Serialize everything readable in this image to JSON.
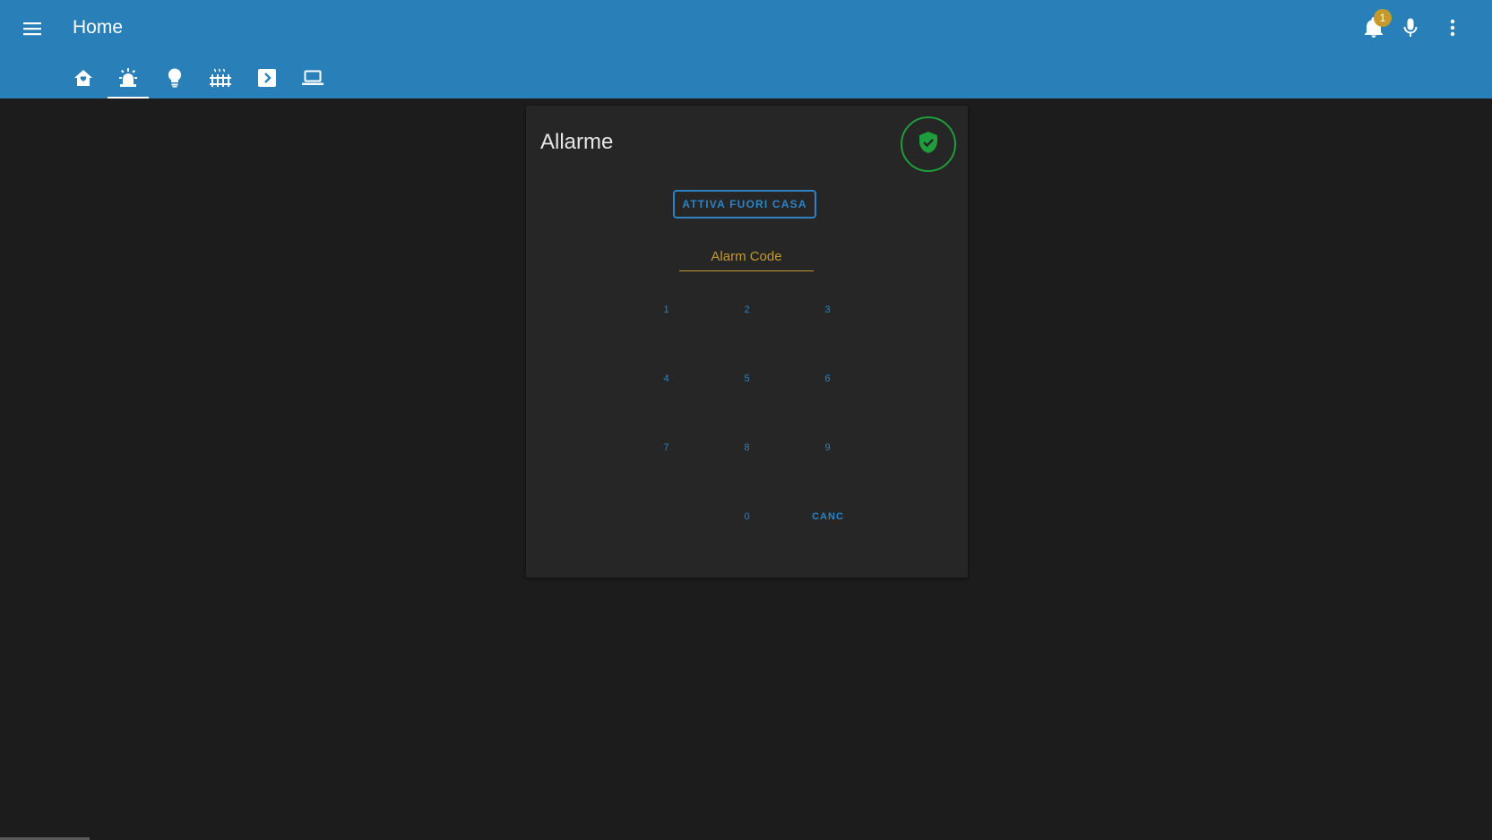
{
  "header": {
    "title": "Home",
    "notification_count": "1",
    "menu_icon": "hamburger-menu-icon",
    "notifications_icon": "bell-icon",
    "voice_icon": "microphone-icon",
    "more_icon": "more-vertical-icon"
  },
  "tabs": [
    {
      "icon": "home-icon",
      "active": false
    },
    {
      "icon": "alarm-light-icon",
      "active": true
    },
    {
      "icon": "lightbulb-icon",
      "active": false
    },
    {
      "icon": "radiator-icon",
      "active": false
    },
    {
      "icon": "chevron-right-box-icon",
      "active": false
    },
    {
      "icon": "laptop-icon",
      "active": false
    }
  ],
  "alarm_panel": {
    "title": "Allarme",
    "state_icon": "shield-check-icon",
    "arm_button_label": "ATTIVA FUORI CASA",
    "code_placeholder": "Alarm Code",
    "keys": [
      "1",
      "2",
      "3",
      "4",
      "5",
      "6",
      "7",
      "8",
      "9",
      "0",
      "CANC"
    ]
  },
  "colors": {
    "header_bg": "#2980b9",
    "page_bg": "#1c1c1c",
    "card_bg": "#262626",
    "accent_blue": "#2b83c5",
    "accent_gold": "#c49a2c",
    "state_green": "#1e9d3a"
  }
}
